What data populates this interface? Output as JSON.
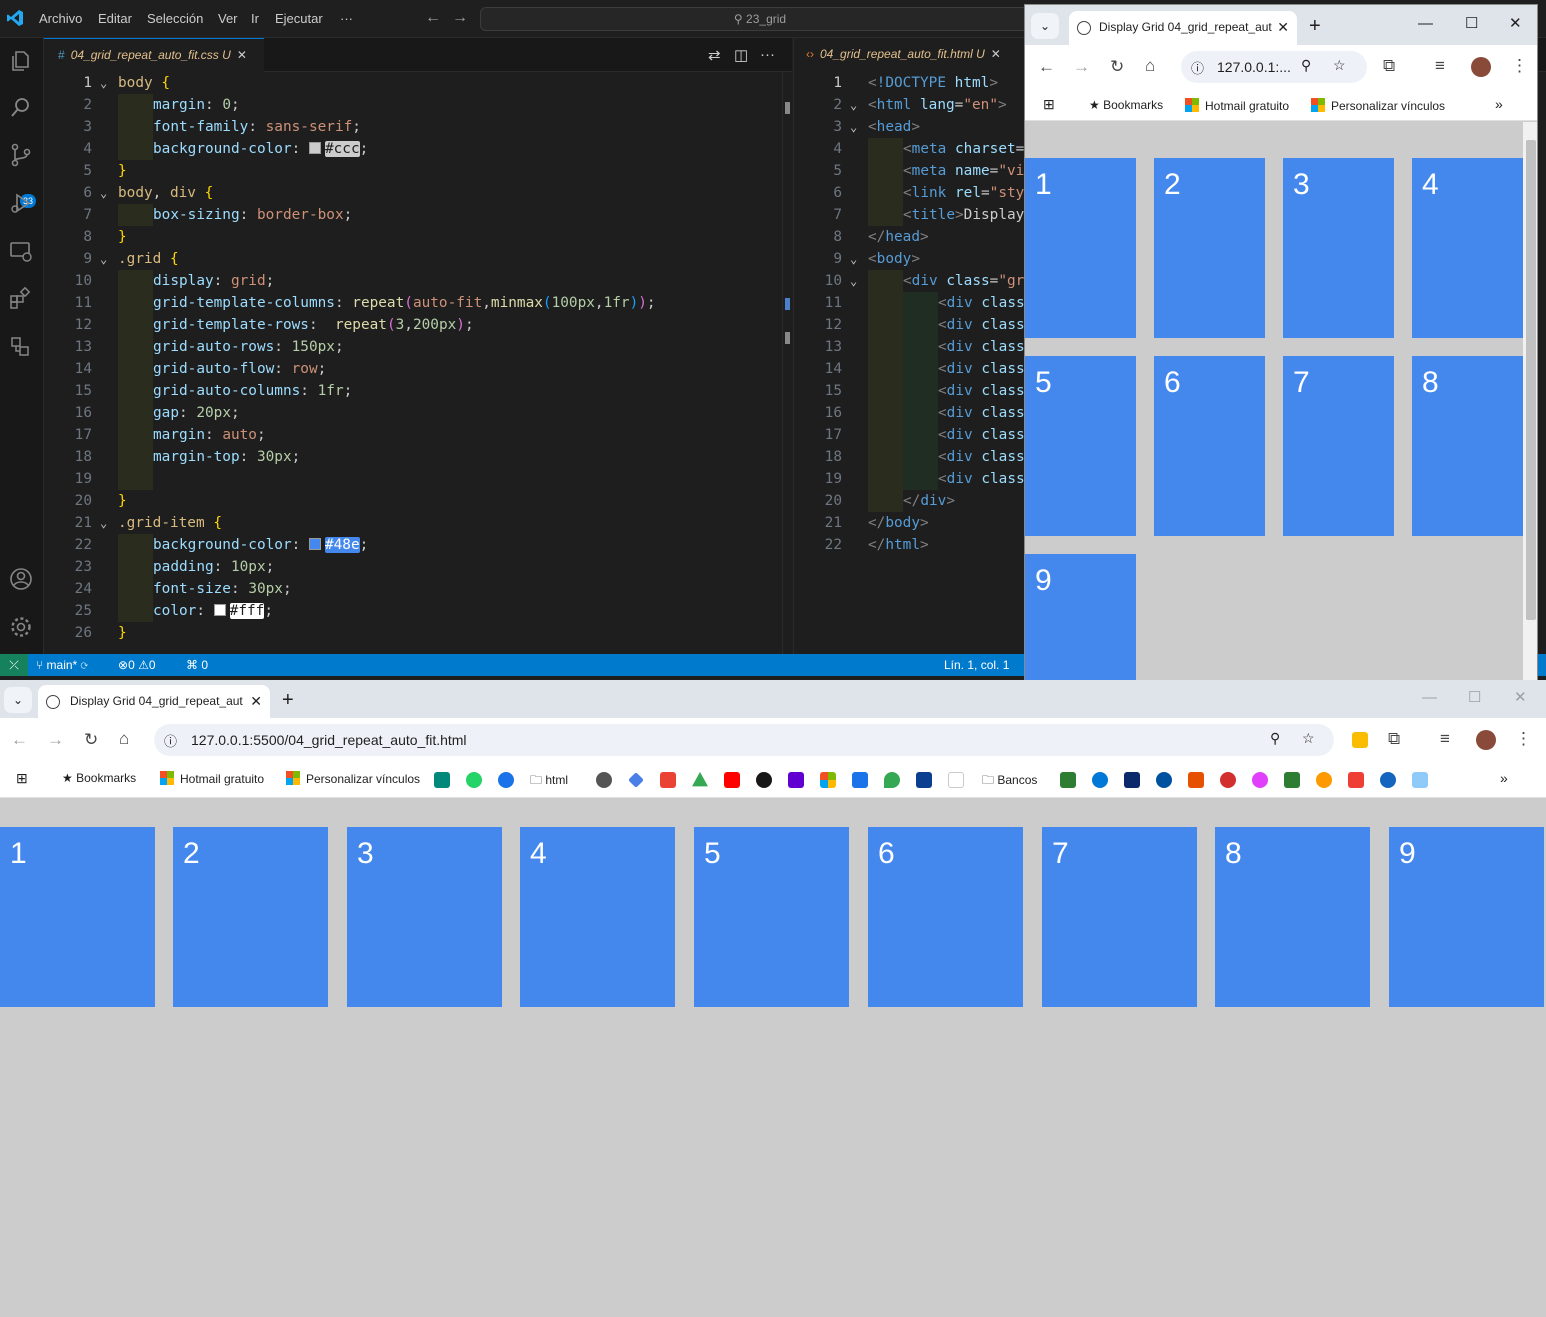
{
  "vscode": {
    "menu": [
      "Archivo",
      "Editar",
      "Selección",
      "Ver",
      "Ir",
      "Ejecutar",
      "···"
    ],
    "search": "23_grid",
    "activity_badge": "33",
    "editor1": {
      "tab_label": "04_grid_repeat_auto_fit.css",
      "tab_status": "U",
      "lines": [
        "1",
        "2",
        "3",
        "4",
        "5",
        "6",
        "7",
        "8",
        "9",
        "10",
        "11",
        "12",
        "13",
        "14",
        "15",
        "16",
        "17",
        "18",
        "19",
        "20",
        "21",
        "22",
        "23",
        "24",
        "25",
        "26"
      ]
    },
    "editor2": {
      "tab_label": "04_grid_repeat_auto_fit.html",
      "tab_status": "U",
      "lines": [
        "1",
        "2",
        "3",
        "4",
        "5",
        "6",
        "7",
        "8",
        "9",
        "10",
        "11",
        "12",
        "13",
        "14",
        "15",
        "16",
        "17",
        "18",
        "19",
        "20",
        "21",
        "22"
      ]
    },
    "status": {
      "branch": "main*",
      "errors": "0",
      "warnings": "0",
      "ports": "0",
      "position": "Lín. 1, col. 1"
    }
  },
  "browser_small": {
    "tab_title": "Display Grid 04_grid_repeat_aut",
    "url": "127.0.0.1:...",
    "bookmarks": [
      "Bookmarks",
      "Hotmail gratuito",
      "Personalizar vínculos"
    ],
    "grid_items": [
      "1",
      "2",
      "3",
      "4",
      "5",
      "6",
      "7",
      "8",
      "9"
    ]
  },
  "browser_large": {
    "tab_title": "Display Grid 04_grid_repeat_aut",
    "url": "127.0.0.1:5500/04_grid_repeat_auto_fit.html",
    "bookmarks": [
      "Bookmarks",
      "Hotmail gratuito",
      "Personalizar vínculos",
      "html",
      "Bancos"
    ],
    "grid_items": [
      "1",
      "2",
      "3",
      "4",
      "5",
      "6",
      "7",
      "8",
      "9"
    ]
  },
  "colors": {
    "grid_item": "#4488ee",
    "page_bg": "#cccccc",
    "vscode_status": "#007acc"
  }
}
